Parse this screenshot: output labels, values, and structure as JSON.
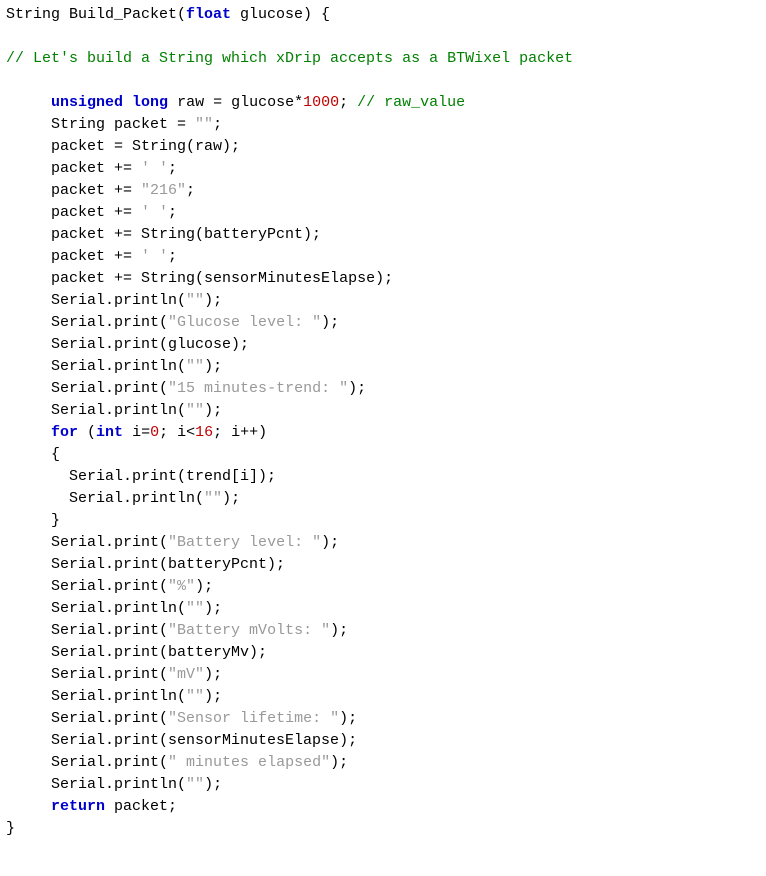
{
  "code": {
    "line1_a": "String Build_Packet(",
    "line1_type": "float",
    "line1_b": " glucose) {",
    "blank": "",
    "comment_top": "// Let's build a String which xDrip accepts as a BTWixel packet",
    "l_raw_a": "unsigned",
    "l_raw_b": " ",
    "l_raw_b2": "long",
    "l_raw_c": " raw = glucose*",
    "l_raw_num": "1000",
    "l_raw_d": "; ",
    "l_raw_comment": "// raw_value",
    "l_pkt_decl_a": "String packet = ",
    "l_pkt_decl_s": "\"\"",
    "l_pkt_decl_b": ";",
    "l_pkt_raw": "packet = String(raw);",
    "l_pkt_sp1_a": "packet += ",
    "l_pkt_sp1_s": "' '",
    "l_pkt_sp1_b": ";",
    "l_pkt_216_a": "packet += ",
    "l_pkt_216_s": "\"216\"",
    "l_pkt_216_b": ";",
    "l_pkt_sp2_a": "packet += ",
    "l_pkt_sp2_s": "' '",
    "l_pkt_sp2_b": ";",
    "l_pkt_bat": "packet += String(batteryPcnt);",
    "l_pkt_sp3_a": "packet += ",
    "l_pkt_sp3_s": "' '",
    "l_pkt_sp3_b": ";",
    "l_pkt_sme": "packet += String(sensorMinutesElapse);",
    "l_sp1_a": "Serial.println(",
    "l_sp1_s": "\"\"",
    "l_sp1_b": ");",
    "l_glu_lbl_a": "Serial.print(",
    "l_glu_lbl_s": "\"Glucose level: \"",
    "l_glu_lbl_b": ");",
    "l_glu_val": "Serial.print(glucose);",
    "l_sp2_a": "Serial.println(",
    "l_sp2_s": "\"\"",
    "l_sp2_b": ");",
    "l_trend_lbl_a": "Serial.print(",
    "l_trend_lbl_s": "\"15 minutes-trend: \"",
    "l_trend_lbl_b": ");",
    "l_sp3_a": "Serial.println(",
    "l_sp3_s": "\"\"",
    "l_sp3_b": ");",
    "l_for_kw": "for",
    "l_for_a": " (",
    "l_for_int": "int",
    "l_for_b": " i=",
    "l_for_z": "0",
    "l_for_c": "; i<",
    "l_for_n": "16",
    "l_for_d": "; i++)",
    "l_brace_o": "{",
    "l_trend_print": "Serial.print(trend[i]);",
    "l_sp4_a": "Serial.println(",
    "l_sp4_s": "\"\"",
    "l_sp4_b": ");",
    "l_brace_c": "}",
    "l_batlvl_a": "Serial.print(",
    "l_batlvl_s": "\"Battery level: \"",
    "l_batlvl_b": ");",
    "l_batpcnt": "Serial.print(batteryPcnt);",
    "l_pct_a": "Serial.print(",
    "l_pct_s": "\"%\"",
    "l_pct_b": ");",
    "l_sp5_a": "Serial.println(",
    "l_sp5_s": "\"\"",
    "l_sp5_b": ");",
    "l_batmv_lbl_a": "Serial.print(",
    "l_batmv_lbl_s": "\"Battery mVolts: \"",
    "l_batmv_lbl_b": ");",
    "l_batmv_val": "Serial.print(batteryMv);",
    "l_mv_a": "Serial.print(",
    "l_mv_s": "\"mV\"",
    "l_mv_b": ");",
    "l_sp6_a": "Serial.println(",
    "l_sp6_s": "\"\"",
    "l_sp6_b": ");",
    "l_slt_lbl_a": "Serial.print(",
    "l_slt_lbl_s": "\"Sensor lifetime: \"",
    "l_slt_lbl_b": ");",
    "l_slt_val": "Serial.print(sensorMinutesElapse);",
    "l_me_a": "Serial.print(",
    "l_me_s": "\" minutes elapsed\"",
    "l_me_b": ");",
    "l_sp7_a": "Serial.println(",
    "l_sp7_s": "\"\"",
    "l_sp7_b": ");",
    "l_ret_kw": "return",
    "l_ret_b": " packet;",
    "l_final": "}"
  }
}
